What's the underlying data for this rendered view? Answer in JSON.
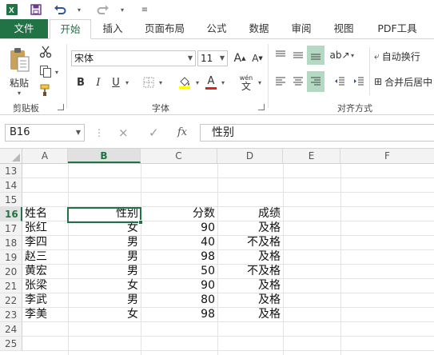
{
  "quick_access": {
    "app_icon": "excel-logo-icon",
    "save_icon": "save-icon",
    "undo_icon": "undo-icon",
    "redo_icon": "redo-icon",
    "customize_icon": "customize-qat-icon"
  },
  "tabs": [
    "文件",
    "开始",
    "插入",
    "页面布局",
    "公式",
    "数据",
    "审阅",
    "视图",
    "PDF工具"
  ],
  "active_tab": "开始",
  "ribbon": {
    "clipboard": {
      "paste_label": "粘贴",
      "group_label": "剪贴板"
    },
    "font": {
      "font_name": "宋体",
      "font_size": "11",
      "grow_label": "A",
      "shrink_label": "A",
      "bold": "B",
      "italic": "I",
      "underline": "U",
      "font_color_label": "A",
      "phonetic_label": "wén",
      "group_label": "字体"
    },
    "alignment": {
      "wrap_text_label": "自动换行",
      "merge_label": "合并后居中",
      "group_label": "对齐方式"
    }
  },
  "formula_bar": {
    "name_box": "B16",
    "cancel_icon": "×",
    "enter_icon": "✓",
    "fx_label": "fx",
    "formula": "性别"
  },
  "columns": [
    "A",
    "B",
    "C",
    "D",
    "E",
    "F"
  ],
  "selected_column": "B",
  "rows": [
    {
      "num": "13",
      "a": "",
      "b": "",
      "c": "",
      "d": ""
    },
    {
      "num": "14",
      "a": "",
      "b": "",
      "c": "",
      "d": ""
    },
    {
      "num": "15",
      "a": "",
      "b": "",
      "c": "",
      "d": ""
    },
    {
      "num": "16",
      "a": "姓名",
      "b": "性别",
      "c": "分数",
      "d": "成绩"
    },
    {
      "num": "17",
      "a": "张红",
      "b": "女",
      "c": "90",
      "d": "及格"
    },
    {
      "num": "18",
      "a": "李四",
      "b": "男",
      "c": "40",
      "d": "不及格"
    },
    {
      "num": "19",
      "a": "赵三",
      "b": "男",
      "c": "98",
      "d": "及格"
    },
    {
      "num": "20",
      "a": "黄宏",
      "b": "男",
      "c": "50",
      "d": "不及格"
    },
    {
      "num": "21",
      "a": "张梁",
      "b": "女",
      "c": "90",
      "d": "及格"
    },
    {
      "num": "22",
      "a": "李武",
      "b": "男",
      "c": "80",
      "d": "及格"
    },
    {
      "num": "23",
      "a": "李美",
      "b": "女",
      "c": "98",
      "d": "及格"
    },
    {
      "num": "24",
      "a": "",
      "b": "",
      "c": "",
      "d": ""
    },
    {
      "num": "25",
      "a": "",
      "b": "",
      "c": "",
      "d": ""
    }
  ],
  "selected_row": "16",
  "colors": {
    "accent": "#217346",
    "highlight": "#b4d9c3"
  }
}
